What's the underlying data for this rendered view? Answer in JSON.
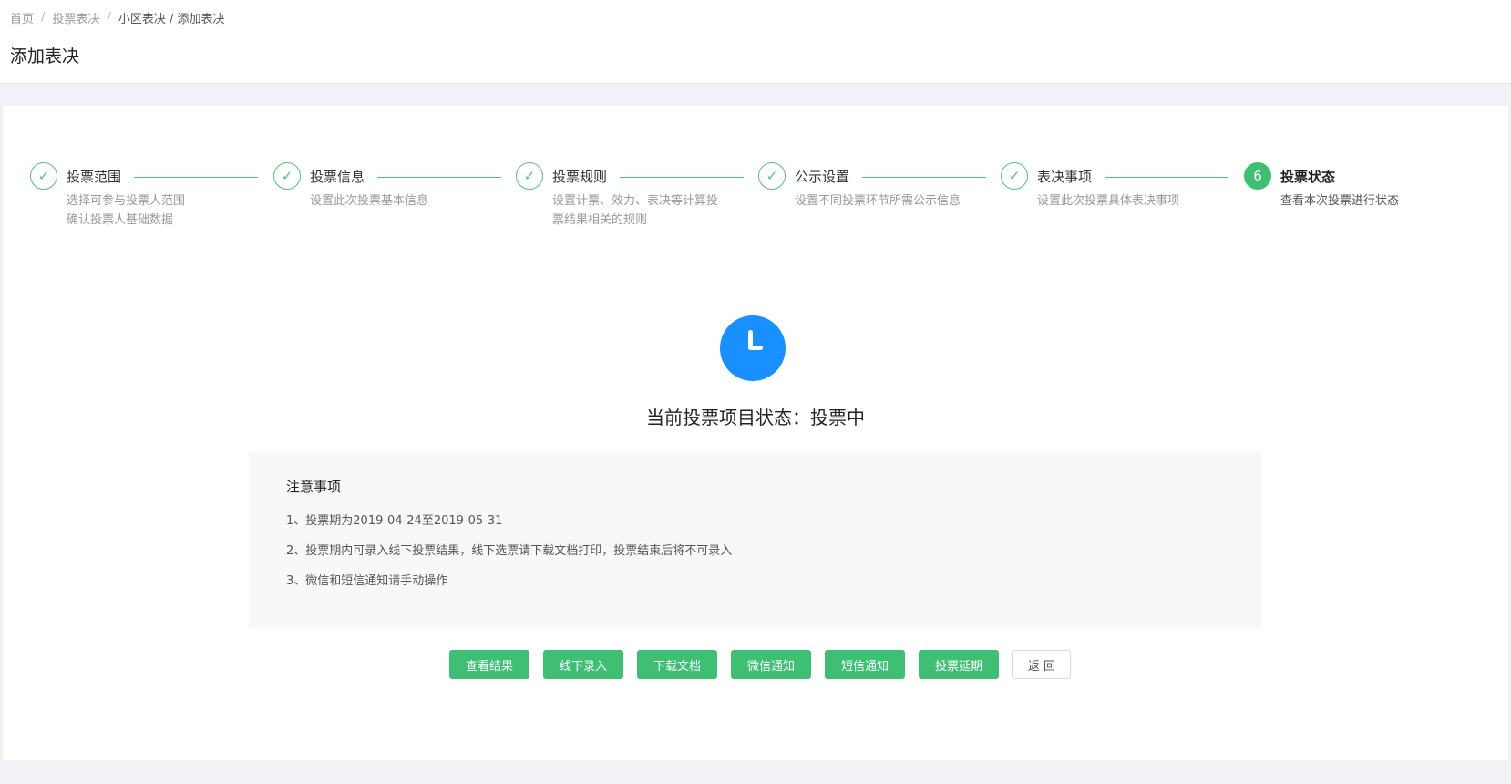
{
  "breadcrumb": {
    "items": [
      "首页",
      "投票表决",
      "小区表决 / 添加表决"
    ],
    "separator": "/"
  },
  "page_title": "添加表决",
  "steps": [
    {
      "title": "投票范围",
      "desc": "选择可参与投票人范围\n确认投票人基础数据",
      "status": "done"
    },
    {
      "title": "投票信息",
      "desc": "设置此次投票基本信息",
      "status": "done"
    },
    {
      "title": "投票规则",
      "desc": "设置计票、效力、表决等计算投\n票结果相关的规则",
      "status": "done"
    },
    {
      "title": "公示设置",
      "desc": "设置不同投票环节所需公示信息",
      "status": "done"
    },
    {
      "title": "表决事项",
      "desc": "设置此次投票具体表决事项",
      "status": "done"
    },
    {
      "title": "投票状态",
      "desc": "查看本次投票进行状态",
      "status": "active",
      "number": "6"
    }
  ],
  "status": {
    "icon": "clock-icon",
    "text": "当前投票项目状态：投票中"
  },
  "notice": {
    "title": "注意事项",
    "items": [
      "1、投票期为2019-04-24至2019-05-31",
      "2、投票期内可录入线下投票结果，线下选票请下载文档打印，投票结束后将不可录入",
      "3、微信和短信通知请手动操作"
    ]
  },
  "actions": {
    "view_result": "查看结果",
    "offline_entry": "线下录入",
    "download_doc": "下载文档",
    "wechat_notify": "微信通知",
    "sms_notify": "短信通知",
    "extend_vote": "投票延期",
    "back": "返 回"
  },
  "colors": {
    "accent_green": "#3fbf74",
    "status_blue": "#1890ff",
    "check_icon": "check-icon"
  }
}
